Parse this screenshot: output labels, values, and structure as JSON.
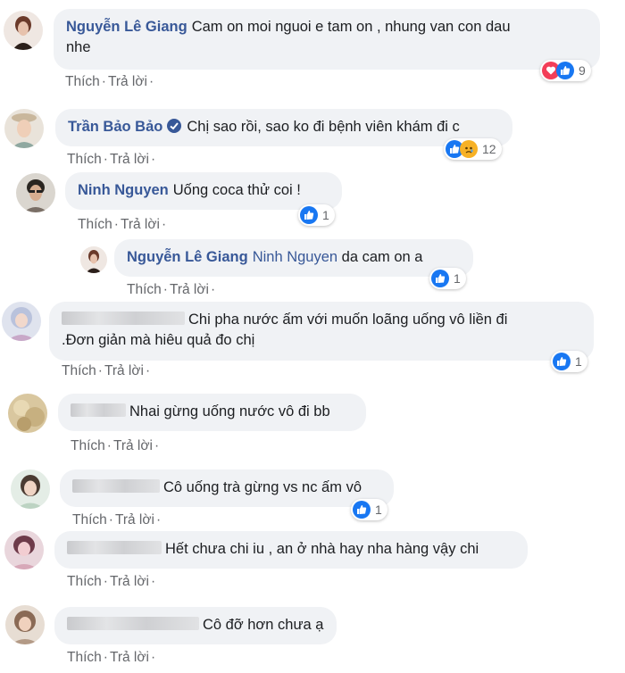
{
  "actions": {
    "like": "Thích",
    "reply": "Trả lời",
    "dot": "·"
  },
  "comments": [
    {
      "author": "Nguyễn Lê Giang",
      "text_line1": "Cam on moi nguoi e tam on , nhung van con dau",
      "text_line2": "nhe",
      "reactions": [
        "love-icon",
        "like-icon"
      ],
      "count": "9"
    },
    {
      "author": "Trần Bảo Bảo",
      "text": "Chị sao rồi, sao ko đi bệnh viên khám đi c",
      "reactions": [
        "like-icon",
        "sad-icon"
      ],
      "count": "12"
    },
    {
      "author": "Ninh Nguyen",
      "text": "Uống coca thử coi !",
      "reactions": [
        "like-icon"
      ],
      "count": "1"
    },
    {
      "author": "Nguyễn Lê Giang",
      "mention": "Ninh Nguyen",
      "text": "da cam on a",
      "reactions": [
        "like-icon"
      ],
      "count": "1"
    },
    {
      "text_line1": "Chi pha nước ấm với muốn loãng uống vô liền đi",
      "text_line2": ".Đơn giản mà hiêu quả đo chị",
      "reactions": [
        "like-icon"
      ],
      "count": "1"
    },
    {
      "text": "Nhai gừng uống nước vô đi bb"
    },
    {
      "text": "Cô uống trà gừng vs nc ấm vô",
      "reactions": [
        "like-icon"
      ],
      "count": "1"
    },
    {
      "text": "Hết chưa chi iu , an ở nhà hay nha hàng vậy chi"
    },
    {
      "text": "Cô đỡ hơn chưa ạ"
    }
  ],
  "colors": {
    "author": "#385898",
    "bubble": "#f0f2f5",
    "like": "#1877f2",
    "love": "#f33e58",
    "sad": "#f7b125"
  }
}
